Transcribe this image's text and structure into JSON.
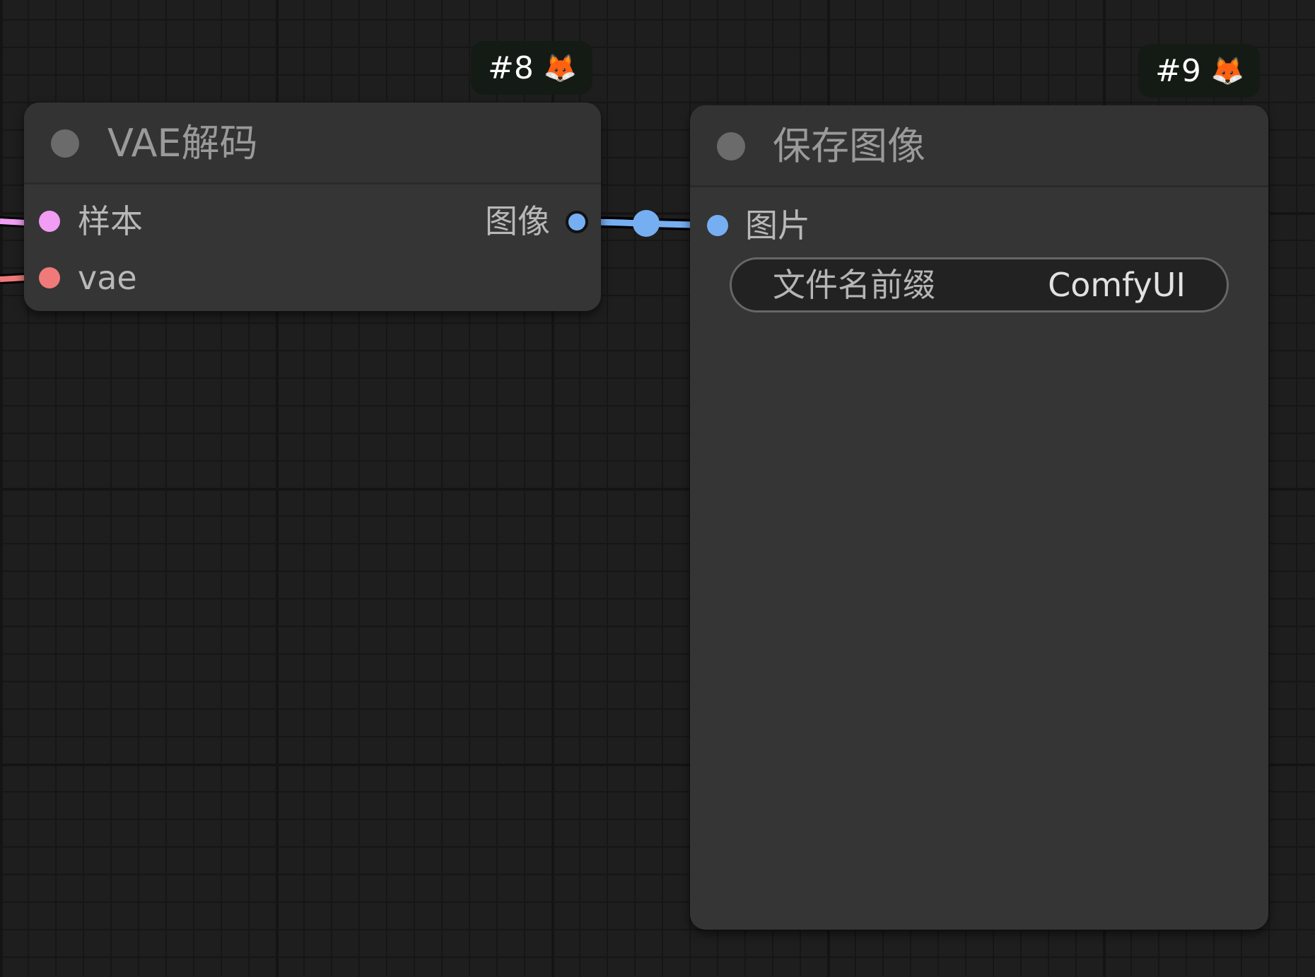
{
  "colors": {
    "latent": "#f09df3",
    "vae": "#f07a7a",
    "image": "#76aef2"
  },
  "node8": {
    "badge_id": "#8",
    "badge_icon": "fox-emoji",
    "badge_glyph": "🦊",
    "title": "VAE解码",
    "inputs": [
      {
        "label": "样本",
        "type": "latent"
      },
      {
        "label": "vae",
        "type": "vae"
      }
    ],
    "outputs": [
      {
        "label": "图像",
        "type": "image"
      }
    ]
  },
  "node9": {
    "badge_id": "#9",
    "badge_icon": "fox-emoji",
    "badge_glyph": "🦊",
    "title": "保存图像",
    "inputs": [
      {
        "label": "图片",
        "type": "image"
      }
    ],
    "widgets": [
      {
        "label": "文件名前缀",
        "value": "ComfyUI"
      }
    ]
  }
}
